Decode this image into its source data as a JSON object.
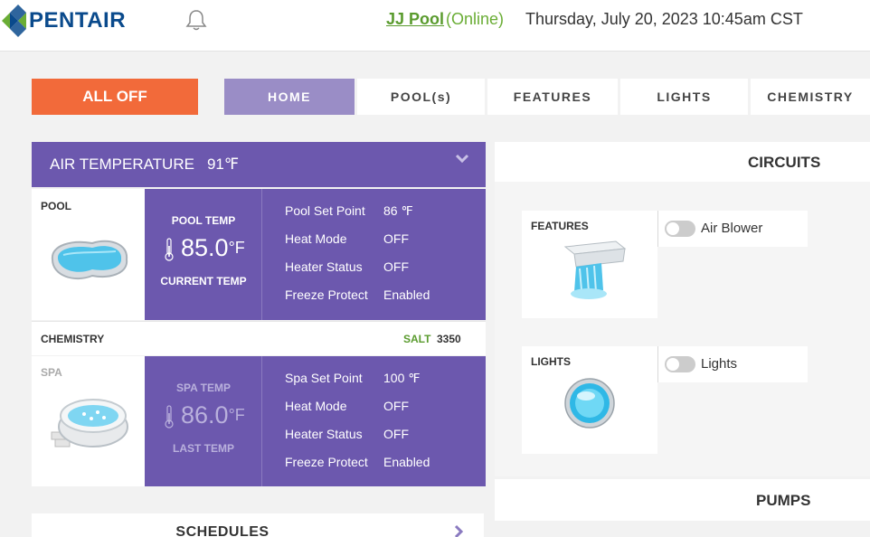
{
  "header": {
    "brand": "PENTAIR",
    "pool_name": "JJ Pool",
    "pool_status": "(Online)",
    "datetime": "Thursday, July 20, 2023 10:45am CST"
  },
  "nav": {
    "all_off": "ALL OFF",
    "tabs": [
      "HOME",
      "POOL(s)",
      "FEATURES",
      "LIGHTS",
      "CHEMISTRY"
    ],
    "active_tab": "HOME"
  },
  "air": {
    "label": "AIR TEMPERATURE",
    "value": "91℉"
  },
  "pool": {
    "section_label": "POOL",
    "temp_title": "POOL TEMP",
    "temp_value": "85.0",
    "temp_unit": "°F",
    "temp_sub": "CURRENT TEMP",
    "rows": [
      {
        "key": "Pool Set Point",
        "value": "86 ℉"
      },
      {
        "key": "Heat Mode",
        "value": "OFF"
      },
      {
        "key": "Heater Status",
        "value": "OFF"
      },
      {
        "key": "Freeze Protect",
        "value": "Enabled"
      }
    ]
  },
  "chemistry": {
    "label": "CHEMISTRY",
    "salt_label": "SALT",
    "salt_value": "3350"
  },
  "spa": {
    "section_label": "SPA",
    "temp_title": "SPA TEMP",
    "temp_value": "86.0",
    "temp_unit": "°F",
    "temp_sub": "LAST TEMP",
    "rows": [
      {
        "key": "Spa Set Point",
        "value": "100 ℉"
      },
      {
        "key": "Heat Mode",
        "value": "OFF"
      },
      {
        "key": "Heater Status",
        "value": "OFF"
      },
      {
        "key": "Freeze Protect",
        "value": "Enabled"
      }
    ]
  },
  "schedules": {
    "label": "SCHEDULES"
  },
  "circuits": {
    "title": "CIRCUITS",
    "features_label": "FEATURES",
    "features_switch": "Air Blower",
    "lights_label": "LIGHTS",
    "lights_switch": "Lights"
  },
  "pumps": {
    "title": "PUMPS"
  },
  "colors": {
    "brand_blue": "#0a4a8c",
    "purple": "#6c58ae",
    "active_tab": "#9a8dc6",
    "all_off": "#f26a3a",
    "online_green": "#6aad35"
  }
}
